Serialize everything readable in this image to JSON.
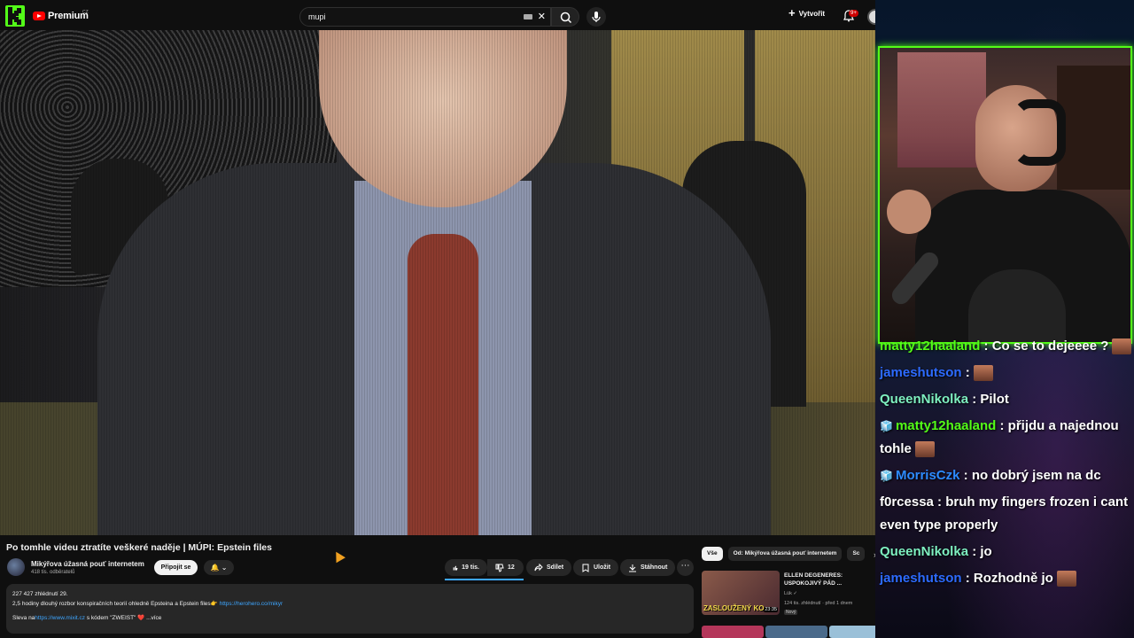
{
  "youtube": {
    "logo_text": "Premium",
    "logo_region": "CZ",
    "search": {
      "value": "mupi"
    },
    "create_label": "Vytvořit",
    "notifications_badge": "9+",
    "video": {
      "title": "Po tomhle videu ztratíte veškeré naděje | MÚPI: Epstein files"
    },
    "channel": {
      "name": "Mikýřova úžasná pouť internetem",
      "subscribers": "418 tis. odběratelů",
      "join_label": "Připojit se",
      "bell_label": "🔔 ⌄"
    },
    "actions": {
      "likes": "19 tis.",
      "dislikes": "12",
      "share": "Sdílet",
      "save": "Uložit",
      "download": "Stáhnout",
      "more": "⋯"
    },
    "description": {
      "stats": "227 427 zhlédnutí  29.",
      "line1": "2,5 hodiny dlouhý rozbor konspiračních teorií ohledně Epsteina a Epstein files👉 ",
      "line1_link": "https://herohero.co/mikyr",
      "line2_prefix": "Sleva na",
      "line2_link": "https://www.mixit.cz",
      "line2_suffix": " s kódem \"ZWEIST\" ❤️ ...více"
    },
    "chips": [
      {
        "label": "Vše"
      },
      {
        "label": "Od: Mikýřova úžasná pouť internetem"
      },
      {
        "label": "Sc"
      }
    ],
    "recommendation": {
      "title": "ELLEN DEGENERES: USPOKOJIVÝ PÁD ...",
      "channel": "Lük ✓",
      "meta": "124 tis. zhlédnutí · před 1 dnem",
      "badge": "Nový",
      "thumb_text": "ZASLOUŽENÝ KO",
      "duration": "23:35"
    }
  },
  "chat": [
    {
      "icons": "",
      "user": "matty12haaland",
      "user_color": "#53fc18",
      "text": " : Co se to dejeeee ?",
      "emote": true
    },
    {
      "icons": "",
      "user": "jameshutson",
      "user_color": "#2d6bff",
      "text": " :",
      "emote": true
    },
    {
      "icons": "",
      "user": "QueenNikolka",
      "user_color": "#7ef0c0",
      "text": " : Pilot",
      "emote": false
    },
    {
      "icons": "🧊",
      "user": "matty12haaland",
      "user_color": "#53fc18",
      "text": " : přijdu a najednou tohle",
      "emote": true
    },
    {
      "icons": "🧊",
      "user": "MorrisCzk",
      "user_color": "#2d8bff",
      "text": " : no dobrý jsem na dc",
      "emote": false
    },
    {
      "icons": "",
      "user": "f0rcessa",
      "user_color": "#ffffff",
      "text": " : bruh my fingers frozen i cant even type properly",
      "emote": false
    },
    {
      "icons": "",
      "user": "QueenNikolka",
      "user_color": "#7ef0c0",
      "text": " : jo",
      "emote": false
    },
    {
      "icons": "",
      "user": "jameshutson",
      "user_color": "#2d6bff",
      "text": " : Rozhodně jo",
      "emote": true
    }
  ],
  "colors": {
    "kick_green": "#53fc18",
    "yt_red": "#ff0000",
    "link_blue": "#3ea6ff"
  },
  "icons": [
    "kick-logo-icon",
    "youtube-play-icon",
    "search-icon",
    "keyboard-icon",
    "close-icon",
    "mic-icon",
    "plus-icon",
    "bell-icon",
    "thumbs-up-icon",
    "thumbs-down-icon",
    "share-icon",
    "save-icon",
    "download-icon",
    "more-icon",
    "chevron-right-icon"
  ]
}
